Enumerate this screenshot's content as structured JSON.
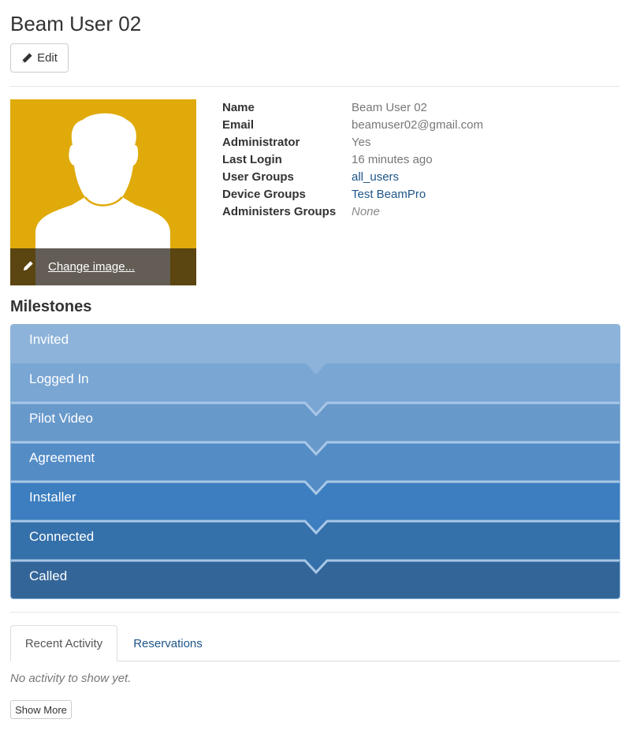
{
  "page": {
    "title": "Beam User 02",
    "edit_label": "Edit"
  },
  "avatar": {
    "change_image_label": "Change image..."
  },
  "details": [
    {
      "label": "Name",
      "value": "Beam User 02",
      "style": "plain"
    },
    {
      "label": "Email",
      "value": "beamuser02@gmail.com",
      "style": "plain"
    },
    {
      "label": "Administrator",
      "value": "Yes",
      "style": "plain"
    },
    {
      "label": "Last Login",
      "value": "16 minutes ago",
      "style": "plain"
    },
    {
      "label": "User Groups",
      "value": "all_users",
      "style": "link"
    },
    {
      "label": "Device Groups",
      "value": "Test BeamPro",
      "style": "link"
    },
    {
      "label": "Administers Groups",
      "value": "None",
      "style": "italic"
    }
  ],
  "milestones_title": "Milestones",
  "milestones": [
    {
      "label": "Invited",
      "color": "#8db3da"
    },
    {
      "label": "Logged In",
      "color": "#79a6d3"
    },
    {
      "label": "Pilot Video",
      "color": "#6899cb"
    },
    {
      "label": "Agreement",
      "color": "#548cc6"
    },
    {
      "label": "Installer",
      "color": "#3c7ebf"
    },
    {
      "label": "Connected",
      "color": "#3470aa"
    },
    {
      "label": "Called",
      "color": "#336598"
    }
  ],
  "tabs": [
    {
      "label": "Recent Activity",
      "active": true
    },
    {
      "label": "Reservations",
      "active": false
    }
  ],
  "activity": {
    "empty_text": "No activity to show yet.",
    "show_more_label": "Show More"
  },
  "colors": {
    "link": "#1d5588",
    "avatar_bg": "#dfaa0a"
  }
}
